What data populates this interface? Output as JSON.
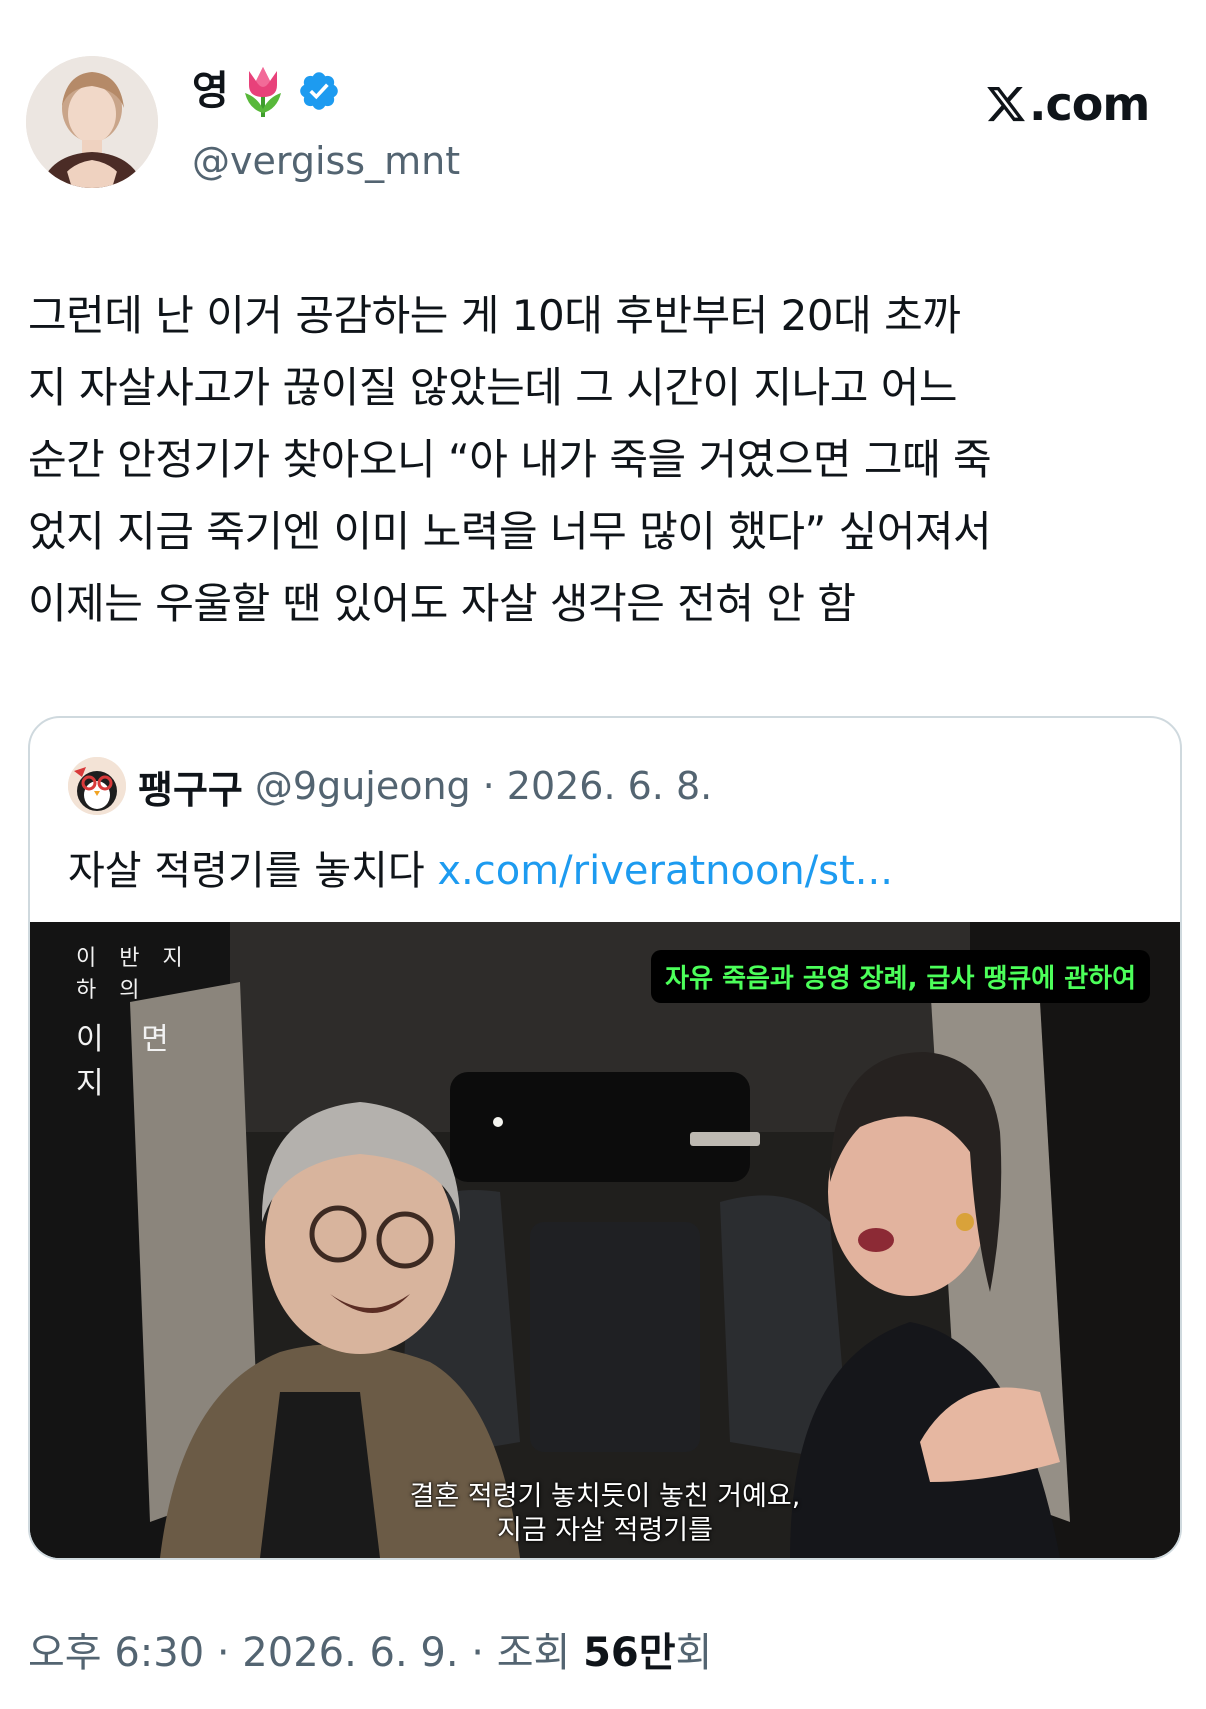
{
  "author": {
    "display_name": "영",
    "name_emoji": "tulip",
    "verified": true,
    "verified_icon": "verified-badge-icon",
    "handle": "@vergiss_mnt"
  },
  "brand": {
    "label": ".com",
    "icon": "x-logo-icon"
  },
  "tweet": {
    "lines": [
      "그런데 난 이거 공감하는 게 10대 후반부터 20대 초까",
      "지 자살사고가 끊이질 않았는데 그 시간이 지나고 어느",
      "순간 안정기가 찾아오니 “아 내가 죽을 거였으면 그때 죽",
      "었지 지금 죽기엔 이미 노력을 너무 많이 했다” 싶어져서",
      "이제는 우울할 땐 있어도 자살 생각은 전혀 안 함"
    ]
  },
  "quoted": {
    "display_name": "팽구구",
    "handle": "@9gujeong",
    "separator": "·",
    "date": "2026. 6. 8.",
    "text": "자살 적령기를 놓치다 ",
    "link": "x.com/riveratnoon/st...",
    "video": {
      "show_title_top": "이 반 지 하 의",
      "show_title_bottom": "이 면 지",
      "topic": "자유 죽음과 공영 장례, 급사 땡큐에 관하여",
      "subtitle_lines": [
        "결혼 적령기 놓치듯이 놓친 거예요,",
        "지금 자살 적령기를"
      ]
    }
  },
  "meta": {
    "time": "오후 6:30",
    "sep1": " · ",
    "date": "2026. 6. 9.",
    "sep2": " · ",
    "views_label": "조회 ",
    "views_value": "56만",
    "views_suffix": "회"
  },
  "colors": {
    "text": "#0f1419",
    "secondary": "#536471",
    "link": "#1d9bf0",
    "verified": "#1d9bf0",
    "border": "#cfd9de",
    "topic_text": "#4cff5a"
  }
}
